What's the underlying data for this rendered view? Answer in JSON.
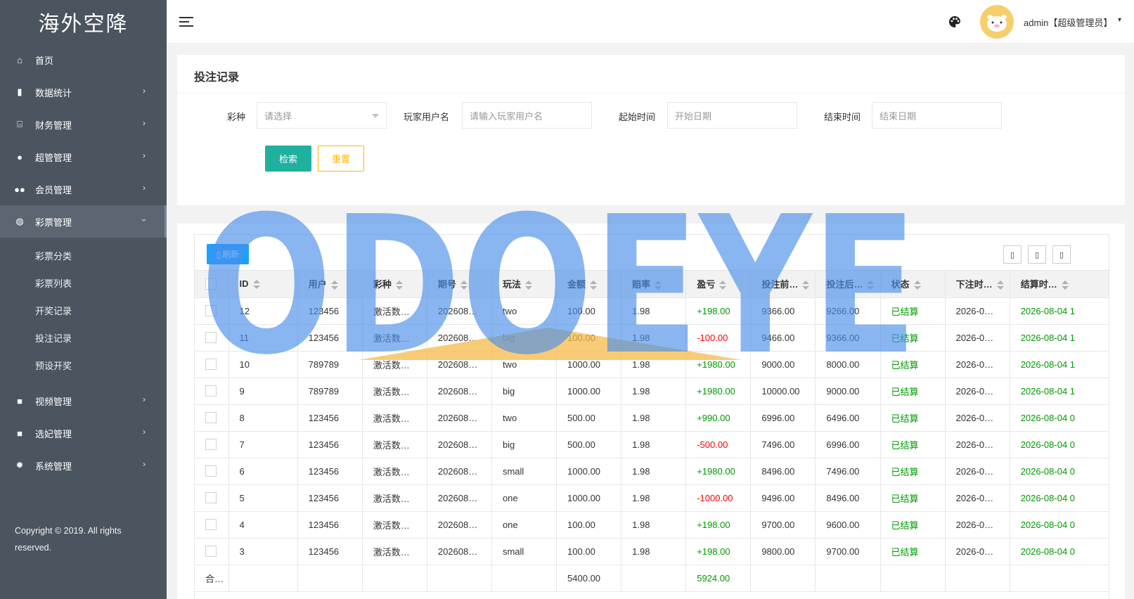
{
  "sidebar": {
    "logo": "海外空降",
    "items": [
      {
        "label": "首页",
        "icon": "home-icon",
        "arrow": ""
      },
      {
        "label": "数据统计",
        "icon": "bar-chart-icon",
        "arrow": "›"
      },
      {
        "label": "财务管理",
        "icon": "bank-icon",
        "arrow": "›"
      },
      {
        "label": "超管管理",
        "icon": "user-icon",
        "arrow": "›"
      },
      {
        "label": "会员管理",
        "icon": "users-icon",
        "arrow": "›"
      },
      {
        "label": "彩票管理",
        "icon": "gamepad-icon",
        "arrow": "›"
      }
    ],
    "subitems": [
      {
        "label": "彩票分类"
      },
      {
        "label": "彩票列表"
      },
      {
        "label": "开奖记录"
      },
      {
        "label": "投注记录"
      },
      {
        "label": "预设开奖"
      }
    ],
    "items_after": [
      {
        "label": "视频管理",
        "icon": "video-icon",
        "arrow": "›"
      },
      {
        "label": "选妃管理",
        "icon": "video-icon",
        "arrow": "›"
      },
      {
        "label": "系统管理",
        "icon": "gear-icon",
        "arrow": "›"
      }
    ],
    "copyright": "Copyright © 2019. All rights reserved."
  },
  "header": {
    "user": "admin【超级管理员】",
    "caret": "▾"
  },
  "search": {
    "title": "投注记录",
    "lottery_label": "彩种",
    "lottery_placeholder": "请选择",
    "player_label": "玩家用户名",
    "player_placeholder": "请输入玩家用户名",
    "start_label": "起始时间",
    "start_placeholder": "开始日期",
    "end_label": "结束时间",
    "end_placeholder": "结束日期",
    "search_button": "检索",
    "reset_button": "重置"
  },
  "table": {
    "refresh_label": "刷新",
    "columns": [
      "ID",
      "用户",
      "彩种",
      "期号",
      "玩法",
      "金额",
      "赔率",
      "盈亏",
      "投注前…",
      "投注后…",
      "状态",
      "下注时…",
      "结算时…"
    ],
    "rows": [
      {
        "id": "12",
        "user": "123456",
        "lottery": "激活数…",
        "issue": "202608…",
        "play": "two",
        "amount": "100.00",
        "odds": "1.98",
        "profit": "+198.00",
        "before": "9366.00",
        "after": "9266.00",
        "status": "已结算",
        "bet_time": "2026-0…",
        "settle_time": "2026-08-04 1"
      },
      {
        "id": "11",
        "user": "123456",
        "lottery": "激活数…",
        "issue": "202608…",
        "play": "big",
        "amount": "100.00",
        "odds": "1.98",
        "profit": "-100.00",
        "before": "9466.00",
        "after": "9366.00",
        "status": "已结算",
        "bet_time": "2026-0…",
        "settle_time": "2026-08-04 1"
      },
      {
        "id": "10",
        "user": "789789",
        "lottery": "激活数…",
        "issue": "202608…",
        "play": "two",
        "amount": "1000.00",
        "odds": "1.98",
        "profit": "+1980.00",
        "before": "9000.00",
        "after": "8000.00",
        "status": "已结算",
        "bet_time": "2026-0…",
        "settle_time": "2026-08-04 1"
      },
      {
        "id": "9",
        "user": "789789",
        "lottery": "激活数…",
        "issue": "202608…",
        "play": "big",
        "amount": "1000.00",
        "odds": "1.98",
        "profit": "+1980.00",
        "before": "10000.00",
        "after": "9000.00",
        "status": "已结算",
        "bet_time": "2026-0…",
        "settle_time": "2026-08-04 1"
      },
      {
        "id": "8",
        "user": "123456",
        "lottery": "激活数…",
        "issue": "202608…",
        "play": "two",
        "amount": "500.00",
        "odds": "1.98",
        "profit": "+990.00",
        "before": "6996.00",
        "after": "6496.00",
        "status": "已结算",
        "bet_time": "2026-0…",
        "settle_time": "2026-08-04 0"
      },
      {
        "id": "7",
        "user": "123456",
        "lottery": "激活数…",
        "issue": "202608…",
        "play": "big",
        "amount": "500.00",
        "odds": "1.98",
        "profit": "-500.00",
        "before": "7496.00",
        "after": "6996.00",
        "status": "已结算",
        "bet_time": "2026-0…",
        "settle_time": "2026-08-04 0"
      },
      {
        "id": "6",
        "user": "123456",
        "lottery": "激活数…",
        "issue": "202608…",
        "play": "small",
        "amount": "1000.00",
        "odds": "1.98",
        "profit": "+1980.00",
        "before": "8496.00",
        "after": "7496.00",
        "status": "已结算",
        "bet_time": "2026-0…",
        "settle_time": "2026-08-04 0"
      },
      {
        "id": "5",
        "user": "123456",
        "lottery": "激活数…",
        "issue": "202608…",
        "play": "one",
        "amount": "1000.00",
        "odds": "1.98",
        "profit": "-1000.00",
        "before": "9496.00",
        "after": "8496.00",
        "status": "已结算",
        "bet_time": "2026-0…",
        "settle_time": "2026-08-04 0"
      },
      {
        "id": "4",
        "user": "123456",
        "lottery": "激活数…",
        "issue": "202608…",
        "play": "one",
        "amount": "100.00",
        "odds": "1.98",
        "profit": "+198.00",
        "before": "9700.00",
        "after": "9600.00",
        "status": "已结算",
        "bet_time": "2026-0…",
        "settle_time": "2026-08-04 0"
      },
      {
        "id": "3",
        "user": "123456",
        "lottery": "激活数…",
        "issue": "202608…",
        "play": "small",
        "amount": "100.00",
        "odds": "1.98",
        "profit": "+198.00",
        "before": "9800.00",
        "after": "9700.00",
        "status": "已结算",
        "bet_time": "2026-0…",
        "settle_time": "2026-08-04 0"
      }
    ],
    "totals": {
      "label": "合…",
      "amount": "5400.00",
      "profit": "5924.00"
    }
  },
  "watermark": {
    "text": "ODOEYE",
    "color": "#4a8fe8",
    "accent": "#f6b94a"
  },
  "colors": {
    "sidebar": "#4a5560",
    "primary": "#1fb19e",
    "warning": "#ffb800",
    "info": "#1e9fff",
    "positive": "#009900",
    "negative": "#ff0000"
  }
}
